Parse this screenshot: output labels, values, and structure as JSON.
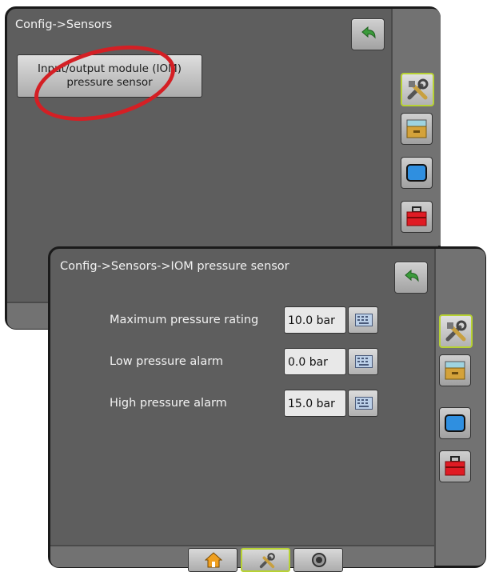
{
  "screen1": {
    "title": "Config->Sensors",
    "iom_button": {
      "line1": "Input/output module (IOM)",
      "line2": "pressure sensor"
    },
    "sidebar_tabs": [
      "tools-icon",
      "console-icon",
      "display-icon",
      "toolbox-icon"
    ]
  },
  "screen2": {
    "title": "Config->Sensors->IOM pressure sensor",
    "settings": [
      {
        "label": "Maximum pressure rating",
        "value": "10.0 bar"
      },
      {
        "label": "Low pressure alarm",
        "value": "0.0 bar"
      },
      {
        "label": "High pressure alarm",
        "value": "15.0 bar"
      }
    ],
    "sidebar_tabs": [
      "tools-icon",
      "console-icon",
      "display-icon",
      "toolbox-icon"
    ],
    "bottom_tabs": [
      "home-icon",
      "tools-icon",
      "guidance-icon"
    ]
  },
  "colors": {
    "accent_active": "#b7d233",
    "highlight_circle": "#d41f24",
    "back_arrow": "#3b9b3b"
  }
}
